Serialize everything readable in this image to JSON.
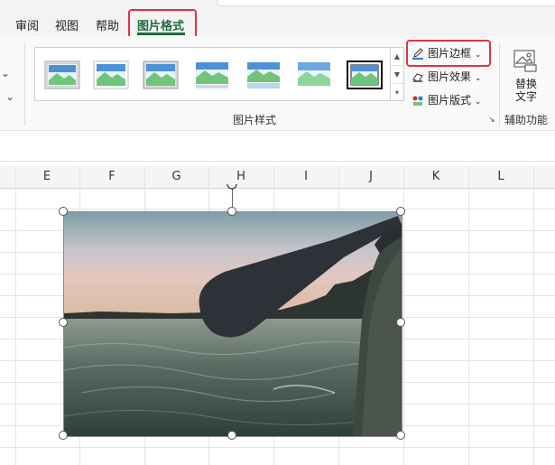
{
  "tabs": [
    {
      "label": "审阅"
    },
    {
      "label": "视图"
    },
    {
      "label": "帮助"
    },
    {
      "label": "图片格式",
      "active": true
    }
  ],
  "ribbon": {
    "left_chevrons": [
      "⌄",
      "⌄"
    ],
    "gallery_scroll": [
      "▲",
      "▼",
      "▾"
    ],
    "styles_group_label": "图片样式",
    "commands": {
      "border": "图片边框",
      "effects": "图片效果",
      "layout": "图片版式"
    },
    "alt_text_line1": "替换",
    "alt_text_line2": "文字",
    "accessibility_group_label": "辅助功能",
    "launcher_glyph": "↘"
  },
  "sheet": {
    "columns": [
      "E",
      "F",
      "G",
      "H",
      "I",
      "J",
      "K",
      "L"
    ]
  },
  "colors": {
    "accent": "#1d6b3b",
    "highlight": "#e2323f"
  },
  "icons": [
    "chevron-down-icon",
    "pencil-border-icon",
    "effects-icon",
    "layout-icon",
    "alt-text-icon",
    "dialog-launcher-icon"
  ]
}
